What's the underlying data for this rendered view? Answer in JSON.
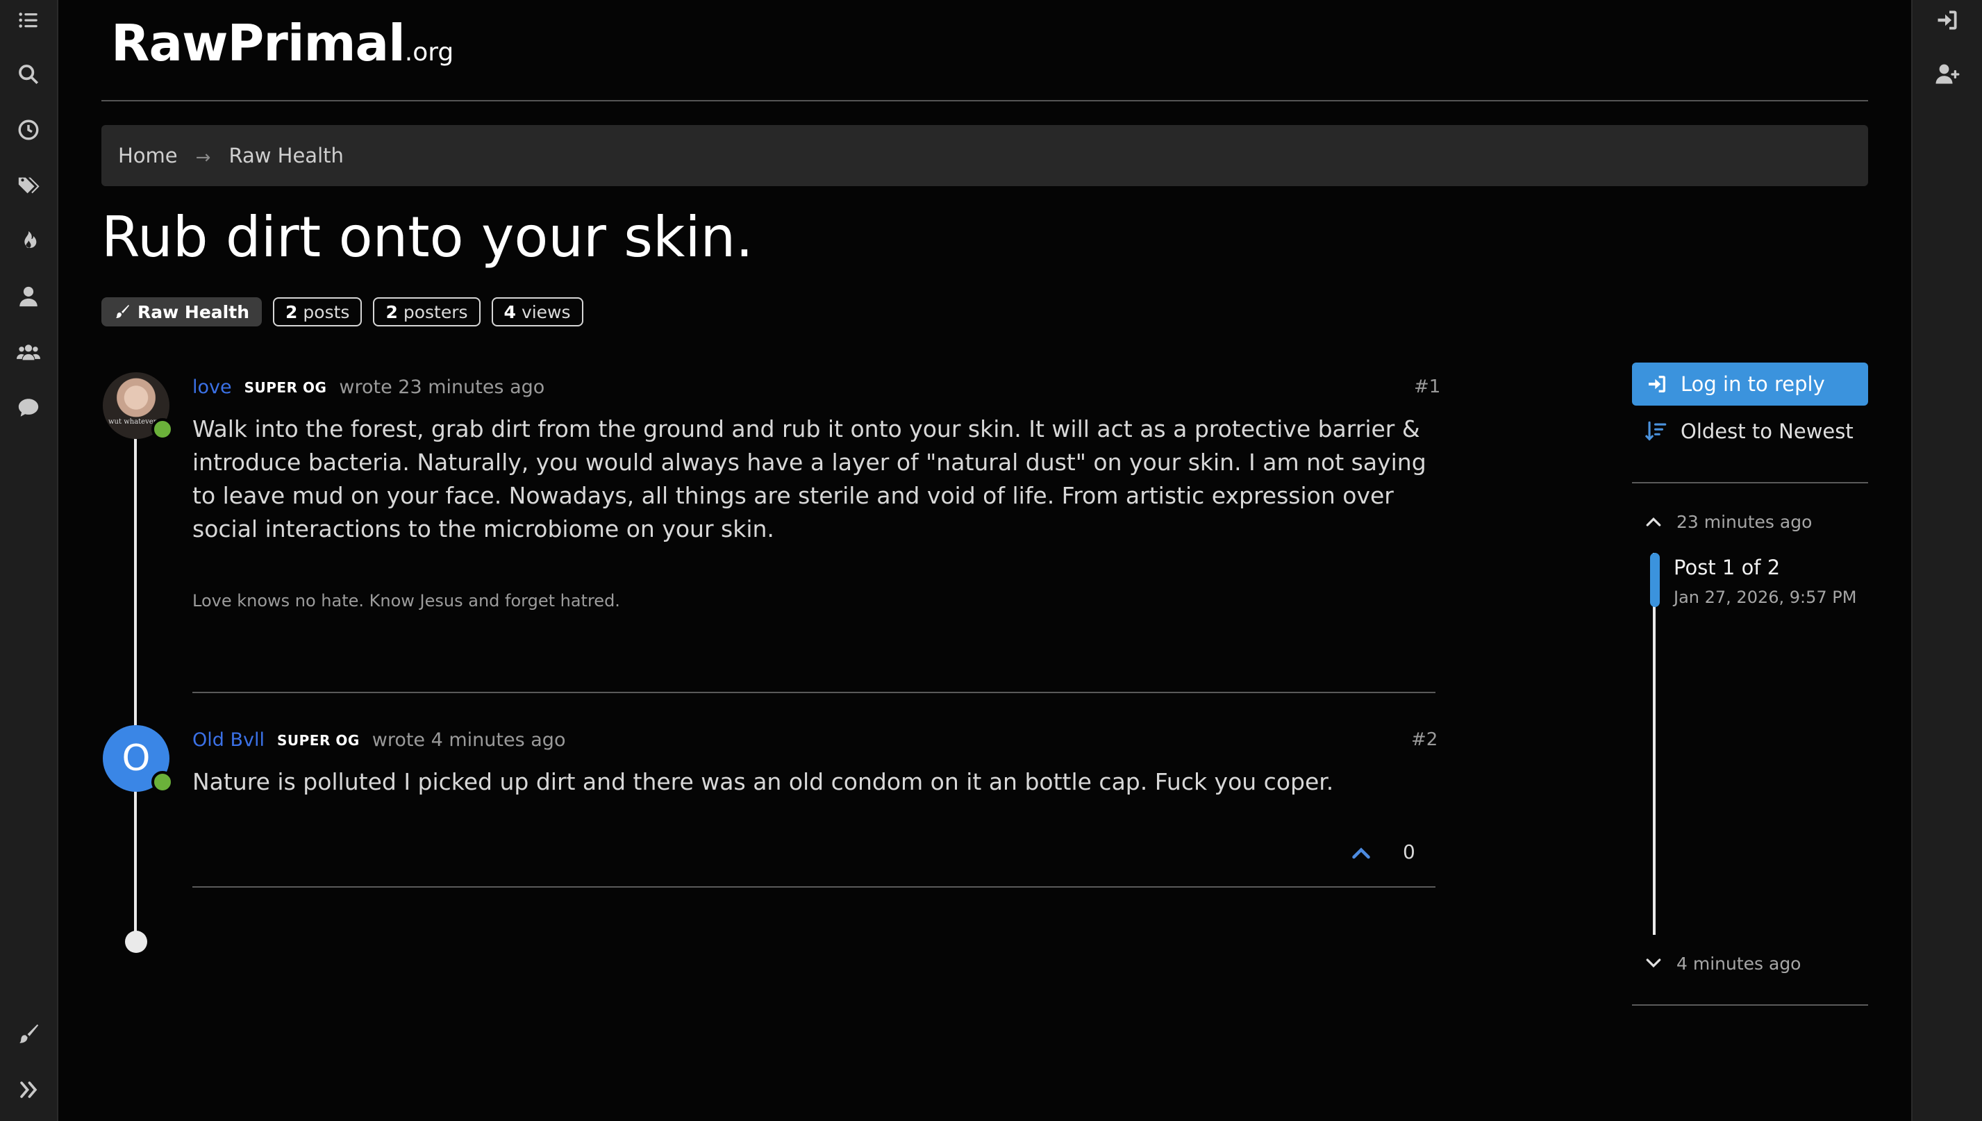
{
  "brand": {
    "main": "RawPrimal",
    "tld": ".org"
  },
  "breadcrumb": {
    "home": "Home",
    "arrow": "→",
    "category": "Raw Health"
  },
  "topic": {
    "title": "Rub dirt onto your skin.",
    "category_tag": "Raw Health",
    "stats": [
      {
        "count": "2",
        "label": "posts"
      },
      {
        "count": "2",
        "label": "posters"
      },
      {
        "count": "4",
        "label": "views"
      }
    ]
  },
  "posts": [
    {
      "username": "love",
      "badge": "SUPER OG",
      "wrote": "wrote 23 minutes ago",
      "index": "#1",
      "body": "Walk into the forest, grab dirt from the ground and rub it onto your skin. It will act as a protective barrier & introduce bacteria. Naturally, you would always have a layer of \"natural dust\" on your skin. I am not saying to leave mud on your face. Nowadays, all things are sterile and void of life. From artistic expression over social interactions to the microbiome on your skin.",
      "signature": "Love knows no hate. Know Jesus and forget hatred.",
      "avatar_text": "wut whatever"
    },
    {
      "username": "Old Bvll",
      "badge": "SUPER OG",
      "wrote": "wrote 4 minutes ago",
      "index": "#2",
      "body": "Nature is polluted I picked up dirt and there was an old condom on it an bottle cap. Fuck you coper.",
      "avatar_letter": "O",
      "votes": "0"
    }
  ],
  "sidebar_right": {
    "login_label": "Log in to reply",
    "sort_label": "Oldest to Newest",
    "pagination_top": "23 minutes ago",
    "current_post": "Post 1 of 2",
    "current_date": "Jan 27, 2026, 9:57 PM",
    "pagination_bottom": "4 minutes ago"
  },
  "colors": {
    "background": "#050505",
    "sidebar": "#1e1e1e",
    "accent_blue": "#3b93dd",
    "username_blue": "#3b71e6",
    "online_green": "#6bb13a"
  },
  "icons": {
    "left_nav": [
      "list-icon",
      "search-icon",
      "clock-icon",
      "tags-icon",
      "fire-icon",
      "user-icon",
      "users-icon",
      "chat-icon",
      "brush-icon",
      "chevrons-right-icon"
    ],
    "right_nav": [
      "login-icon",
      "user-plus-icon"
    ]
  }
}
